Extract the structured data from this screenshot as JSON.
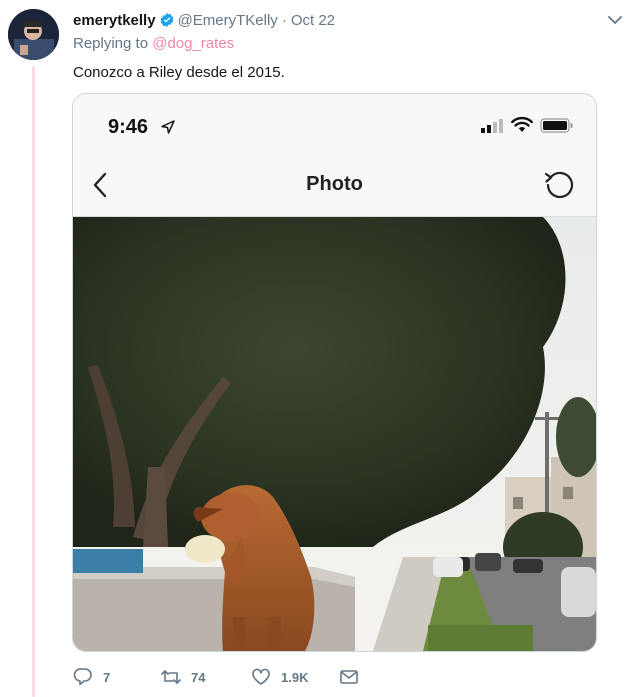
{
  "tweet": {
    "display_name": "emerytkelly",
    "handle": "@EmeryTKelly",
    "separator": "·",
    "date": "Oct 22",
    "replying_prefix": "Replying to",
    "replying_handle": "@dog_rates",
    "text": "Conozco a Riley desde el 2015."
  },
  "media": {
    "status_time": "9:46",
    "nav_title": "Photo"
  },
  "actions": {
    "reply_count": "7",
    "retweet_count": "74",
    "like_count": "1.9K"
  },
  "colors": {
    "verified": "#1da1f2",
    "muted": "#657786",
    "thread_line": "#fdd9de",
    "reply_handle": "#e0245e"
  },
  "icons": [
    "verified-icon",
    "chevron-down-icon",
    "location-arrow-icon",
    "signal-icon",
    "wifi-icon",
    "battery-icon",
    "back-icon",
    "refresh-icon",
    "reply-icon",
    "retweet-icon",
    "like-icon",
    "direct-message-icon"
  ]
}
